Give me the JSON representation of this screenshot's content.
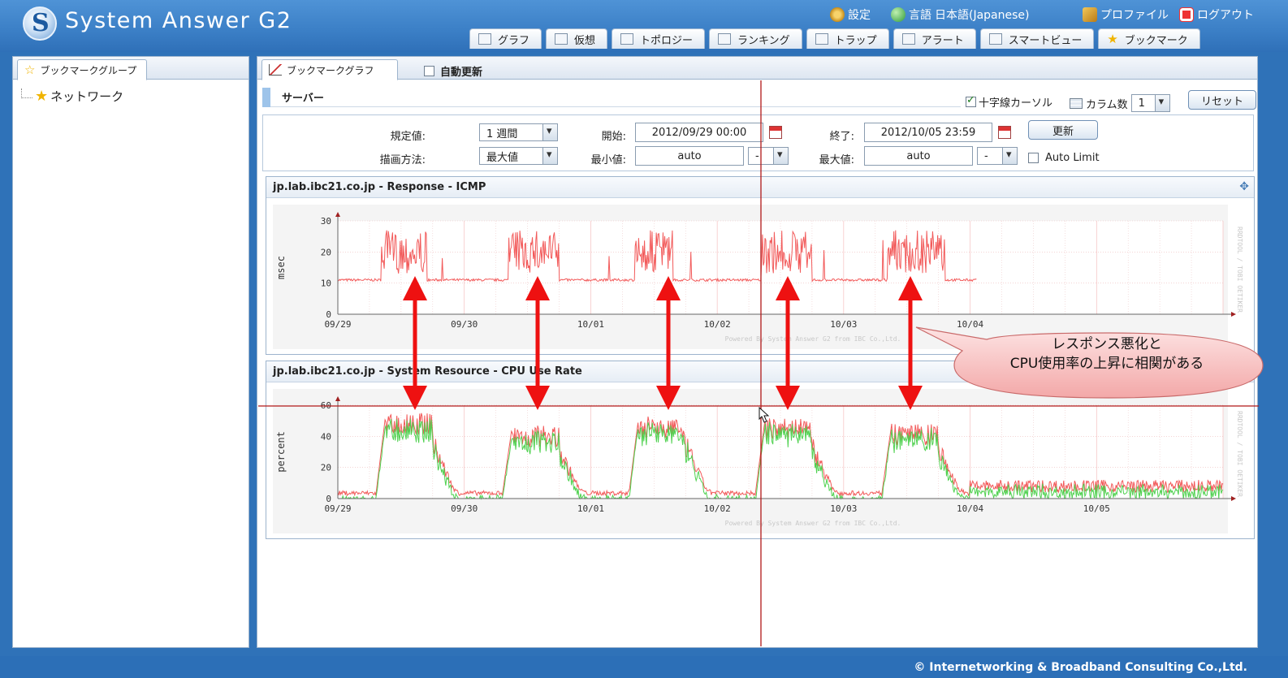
{
  "header": {
    "app_title": "System Answer G2",
    "settings": "設定",
    "language_label": "言語",
    "language_value": "日本語(Japanese)",
    "profile": "プロファイル",
    "logout": "ログアウト"
  },
  "nav_tabs": [
    "グラフ",
    "仮想",
    "トポロジー",
    "ランキング",
    "トラップ",
    "アラート",
    "スマートビュー",
    "ブックマーク"
  ],
  "left_panel": {
    "tab": "ブックマークグループ",
    "tree_item": "ネットワーク"
  },
  "main": {
    "tab": "ブックマークグラフ",
    "auto_refresh": "自動更新",
    "section_title": "サーバー",
    "crosshair": "十字線カーソル",
    "column_count_label": "カラム数",
    "column_count": "1",
    "reset": "リセット"
  },
  "filters": {
    "preset_label": "規定値:",
    "preset_value": "1 週間",
    "draw_label": "描画方法:",
    "draw_value": "最大値",
    "start_label": "開始:",
    "start_value": "2012/09/29 00:00",
    "end_label": "終了:",
    "end_value": "2012/10/05 23:59",
    "min_label": "最小値:",
    "min_value": "auto",
    "min_unit": "-",
    "max_label": "最大値:",
    "max_value": "auto",
    "max_unit": "-",
    "update": "更新",
    "auto_limit": "Auto Limit"
  },
  "callout": {
    "line1": "レスポンス悪化と",
    "line2": "CPU使用率の上昇に相関がある"
  },
  "footer": {
    "copyright": "© Internetworking & Broadband Consulting Co.,Ltd."
  },
  "colors": {
    "series_red": "#f25a5a",
    "series_green": "#4fd14f",
    "arrow": "#ee1111",
    "crosshair": "#b01818"
  },
  "chart_data": [
    {
      "type": "line",
      "title": "jp.lab.ibc21.co.jp - Response - ICMP",
      "ylabel": "msec",
      "ylim": [
        0,
        30
      ],
      "y_ticks": [
        "0",
        "10",
        "20",
        "30"
      ],
      "x_ticks": [
        "09/29",
        "09/30",
        "10/01",
        "10/02",
        "10/03",
        "10/04"
      ],
      "watermark": "Powered By System Answer G2 from IBC Co.,Ltd.",
      "side_text": "RRDTOOL / TOBI OETIKER",
      "baseline": 11,
      "busy_periods": [
        [
          0.35,
          0.7
        ],
        [
          1.35,
          1.75
        ],
        [
          2.35,
          2.65
        ],
        [
          3.35,
          3.75
        ],
        [
          4.35,
          4.8
        ]
      ],
      "busy_peak": 27,
      "series": [
        {
          "values": []
        }
      ]
    },
    {
      "type": "line",
      "title": "jp.lab.ibc21.co.jp - System Resource - CPU Use Rate",
      "ylabel": "percent",
      "ylim": [
        0,
        60
      ],
      "y_ticks": [
        "0",
        "20",
        "40",
        "60"
      ],
      "x_ticks": [
        "09/29",
        "09/30",
        "10/01",
        "10/02",
        "10/03",
        "10/04",
        "10/05"
      ],
      "watermark": "Powered By System Answer G2 from IBC Co.,Ltd.",
      "side_text": "RRDTOOL / TOBI OETIKER",
      "daily_peaks": [
        55,
        47,
        53,
        52,
        48,
        5,
        10
      ],
      "series": [
        {
          "values": []
        },
        {
          "values": []
        }
      ]
    }
  ]
}
